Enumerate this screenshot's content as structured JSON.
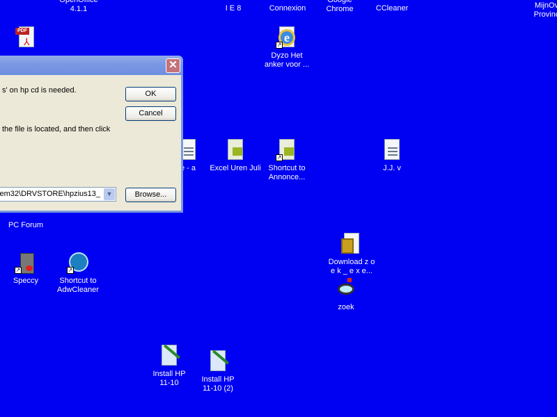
{
  "desktop": {
    "icons": [
      {
        "label": "OpenOffice\n4.1.1",
        "icon": "openoffice-icon"
      },
      {
        "label": "I E 8",
        "icon": "ie-icon"
      },
      {
        "label": "Connexion",
        "icon": "app-icon"
      },
      {
        "label": "Google\nChrome",
        "icon": "chrome-icon"
      },
      {
        "label": "CCleaner",
        "icon": "ccleaner-icon"
      },
      {
        "label": "MijnOv\nProvinc",
        "icon": "app-icon"
      },
      {
        "label": "",
        "icon": "pdf-icon"
      },
      {
        "label": "Dyzo  Het\nanker voor ...",
        "icon": "ie-shortcut-icon"
      },
      {
        "label": "e - a",
        "icon": "document-icon"
      },
      {
        "label": "Excel Uren Juli",
        "icon": "spreadsheet-icon"
      },
      {
        "label": "Shortcut to\nAnnonce...",
        "icon": "spreadsheet-shortcut-icon"
      },
      {
        "label": "J.J. v",
        "icon": "document-icon"
      },
      {
        "label": "PC Forum",
        "icon": "folder-icon"
      },
      {
        "label": "Speccy",
        "icon": "speccy-icon"
      },
      {
        "label": "Shortcut to\nAdwCleaner",
        "icon": "adwcleaner-icon"
      },
      {
        "label": "Download z o\ne k _ e x e...",
        "icon": "image-file-icon"
      },
      {
        "label": "zoek",
        "icon": "magnifier-icon"
      },
      {
        "label": "Install HP\n11-10",
        "icon": "paint-file-icon"
      },
      {
        "label": "Install HP\n11-10 (2)",
        "icon": "paint-file-icon"
      }
    ]
  },
  "dialog": {
    "message1": "s' on hp cd is needed.",
    "message2": "the file is located, and then click",
    "path_value": "em32\\DRVSTORE\\hpzius13_",
    "ok_label": "OK",
    "cancel_label": "Cancel",
    "browse_label": "Browse...",
    "close_glyph": "✕"
  }
}
